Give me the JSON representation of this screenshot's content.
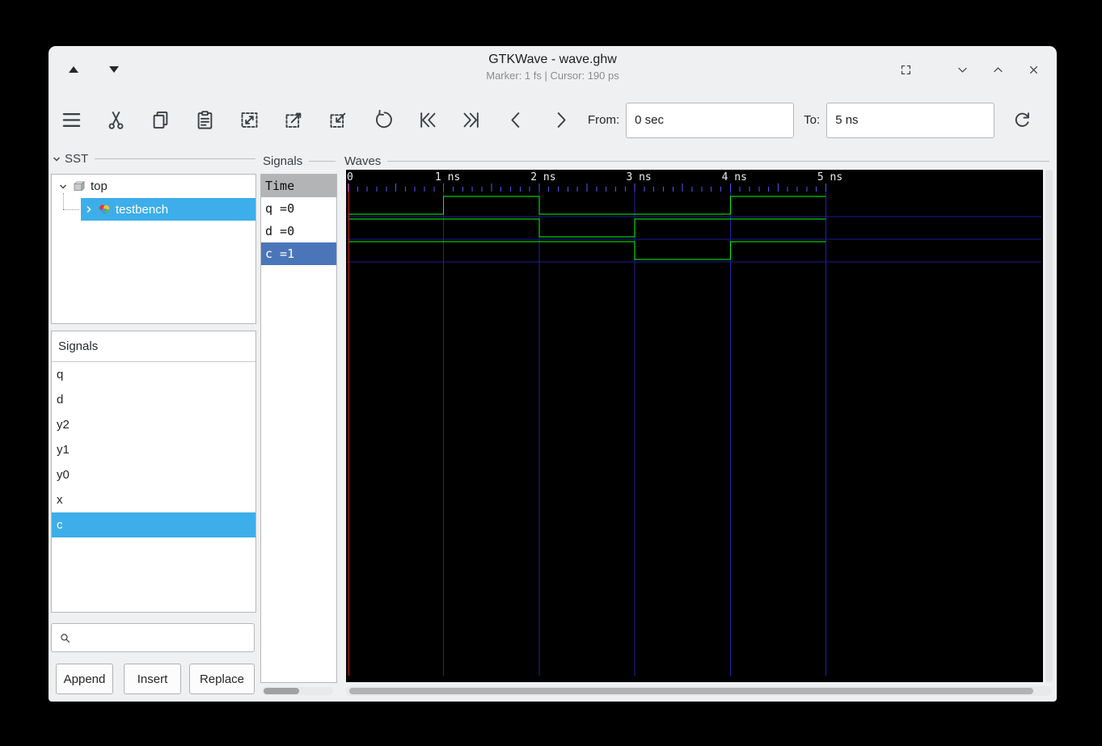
{
  "window": {
    "title": "GTKWave - wave.ghw",
    "status": "Marker: 1 fs | Cursor: 190 ps",
    "controls": [
      {
        "name": "fullscreen",
        "icon": "fullscreen-icon"
      },
      {
        "name": "minimize",
        "icon": "minimize-icon"
      },
      {
        "name": "maximize",
        "icon": "maximize-icon"
      },
      {
        "name": "close",
        "icon": "close-icon"
      }
    ]
  },
  "toolbar": {
    "buttons": [
      {
        "name": "menu",
        "icon": "menu-icon"
      },
      {
        "name": "cut",
        "icon": "cut-icon"
      },
      {
        "name": "copy",
        "icon": "copy-icon"
      },
      {
        "name": "paste",
        "icon": "paste-icon"
      },
      {
        "name": "zoom-fit",
        "icon": "zoom-fit-icon"
      },
      {
        "name": "zoom-out",
        "icon": "zoom-out-icon"
      },
      {
        "name": "zoom-in",
        "icon": "zoom-in-icon"
      },
      {
        "name": "undo",
        "icon": "undo-icon"
      },
      {
        "name": "to-start",
        "icon": "skip-start-icon"
      },
      {
        "name": "to-end",
        "icon": "skip-end-icon"
      },
      {
        "name": "step-back",
        "icon": "chevron-left-icon"
      },
      {
        "name": "step-forward",
        "icon": "chevron-right-icon"
      }
    ],
    "from_label": "From:",
    "from_value": "0 sec",
    "to_label": "To:",
    "to_value": "5 ns",
    "reload_icon": "reload-icon"
  },
  "sst": {
    "title": "SST",
    "tree": [
      {
        "label": "top",
        "icon": "cube-icon",
        "chevron": "down",
        "indent": 0,
        "selected": false
      },
      {
        "label": "testbench",
        "icon": "module-icon",
        "chevron": "right",
        "indent": 1,
        "selected": true
      }
    ],
    "signals_title": "Signals",
    "signals": [
      {
        "label": "q",
        "selected": false
      },
      {
        "label": "d",
        "selected": false
      },
      {
        "label": "y2",
        "selected": false
      },
      {
        "label": "y1",
        "selected": false
      },
      {
        "label": "y0",
        "selected": false
      },
      {
        "label": "x",
        "selected": false
      },
      {
        "label": "c",
        "selected": true
      }
    ],
    "search_value": "",
    "buttons": [
      "Append",
      "Insert",
      "Replace"
    ]
  },
  "signals_panel": {
    "title": "Signals",
    "header": "Time",
    "rows": [
      {
        "label": "q =0",
        "selected": false
      },
      {
        "label": "d =0",
        "selected": false
      },
      {
        "label": "c =1",
        "selected": true
      }
    ]
  },
  "waves": {
    "title": "Waves"
  },
  "chart_data": {
    "type": "line",
    "subtype": "digital-waveform",
    "title": "GTKWave signal traces",
    "x_unit": "ns",
    "x_range": [
      0,
      5
    ],
    "x_ticks": [
      {
        "t": 0,
        "label": "0"
      },
      {
        "t": 1,
        "label": "1 ns"
      },
      {
        "t": 2,
        "label": "2 ns"
      },
      {
        "t": 3,
        "label": "3 ns"
      },
      {
        "t": 4,
        "label": "4 ns"
      },
      {
        "t": 5,
        "label": "5 ns"
      }
    ],
    "minor_tick_ns": 0.1,
    "grid_ns": 1,
    "marker_time": "1 fs",
    "cursor_time": "190 ps",
    "series": [
      {
        "name": "q",
        "value_label": "=0",
        "points": [
          [
            0,
            0
          ],
          [
            1,
            1
          ],
          [
            2,
            0
          ],
          [
            4,
            1
          ]
        ],
        "end": 5
      },
      {
        "name": "d",
        "value_label": "=0",
        "points": [
          [
            0,
            1
          ],
          [
            2,
            0
          ],
          [
            3,
            1
          ]
        ],
        "end": 5
      },
      {
        "name": "c",
        "value_label": "=1",
        "points": [
          [
            0,
            1
          ],
          [
            3,
            0
          ],
          [
            4,
            1
          ]
        ],
        "end": 5
      }
    ],
    "colors": {
      "background": "#000000",
      "trace": "#00ff00",
      "grid": "#2222a8",
      "row_separator": "#1d1d99",
      "ticks": "#5353ff",
      "marker": "#cc2222",
      "label": "#ededed"
    }
  }
}
